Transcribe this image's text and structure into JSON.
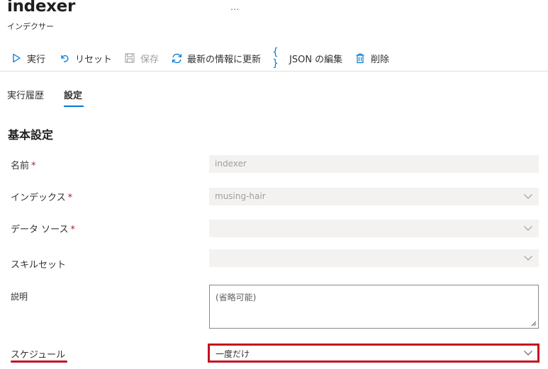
{
  "header": {
    "title": "indexer",
    "subtitle": "インデクサー",
    "more": "…"
  },
  "toolbar": {
    "run_label": "実行",
    "reset_label": "リセット",
    "save_label": "保存",
    "refresh_label": "最新の情報に更新",
    "json_label": "JSON の編集",
    "delete_label": "削除",
    "json_icon_text": "{ }"
  },
  "tabs": {
    "history_label": "実行履歴",
    "settings_label": "設定"
  },
  "section": {
    "title": "基本設定"
  },
  "form": {
    "name_label": "名前",
    "name_value": "indexer",
    "index_label": "インデックス",
    "index_value": "musing-hair",
    "datasource_label": "データ ソース",
    "datasource_value": "",
    "skillset_label": "スキルセット",
    "skillset_value": "",
    "description_label": "説明",
    "description_placeholder": "(省略可能)",
    "schedule_label": "スケジュール",
    "schedule_value": "一度だけ",
    "required_mark": "*"
  },
  "colors": {
    "accent": "#0078d4",
    "highlight": "#c50f1f",
    "required": "#a4262c"
  }
}
